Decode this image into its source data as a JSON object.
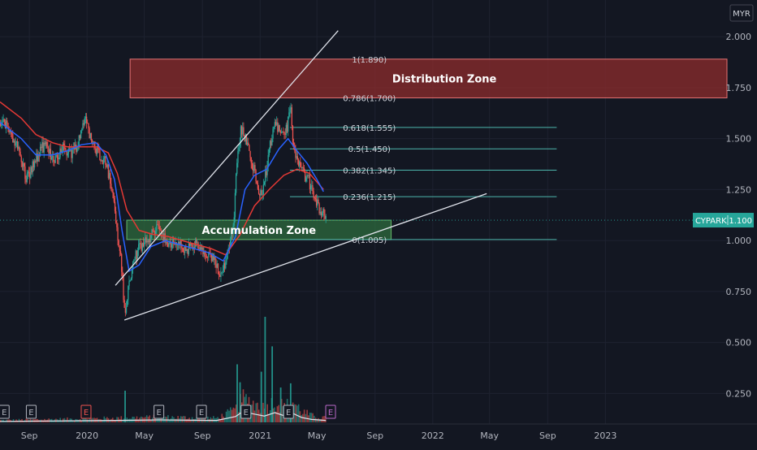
{
  "chart_data": {
    "type": "candlestick",
    "symbol": "CYPARK",
    "currency": "MYR",
    "last_price": "1.100",
    "colors": {
      "background": "#131722",
      "grid": "#1e2230",
      "axis_text": "#b2b5be",
      "up": "#26a69a",
      "down": "#ef5350",
      "ma_fast": "#2962ff",
      "ma_slow": "#e53935",
      "trendline": "#e0e3eb",
      "fib_line": "#4db6ac",
      "distribution_fill": "#8e2c2c",
      "distribution_border": "#e57373",
      "accumulation_fill": "#2e6b3e",
      "accumulation_border": "#66bb6a",
      "price_badge": "#26a69a",
      "earnings_default": "#b2b5be",
      "earnings_miss": "#ef5350",
      "earnings_upcoming": "#ba68c8",
      "volume_ma": "#e0e3eb"
    },
    "y_axis": {
      "min": 0.1,
      "max": 2.18,
      "ticks": [
        {
          "value": 0.25,
          "label": "0.250"
        },
        {
          "value": 0.5,
          "label": "0.500"
        },
        {
          "value": 0.75,
          "label": "0.750"
        },
        {
          "value": 1.0,
          "label": "1.000"
        },
        {
          "value": 1.25,
          "label": "1.250"
        },
        {
          "value": 1.5,
          "label": "1.500"
        },
        {
          "value": 1.75,
          "label": "1.750"
        },
        {
          "value": 2.0,
          "label": "2.000"
        }
      ]
    },
    "x_axis": {
      "start": "2019-07-01",
      "end": "2023-09-15",
      "ticks": [
        {
          "date": "2019-09-01",
          "label": "Sep"
        },
        {
          "date": "2020-01-01",
          "label": "2020"
        },
        {
          "date": "2020-05-01",
          "label": "May"
        },
        {
          "date": "2020-09-01",
          "label": "Sep"
        },
        {
          "date": "2021-01-01",
          "label": "2021"
        },
        {
          "date": "2021-05-01",
          "label": "May"
        },
        {
          "date": "2021-09-01",
          "label": "Sep"
        },
        {
          "date": "2022-01-01",
          "label": "2022"
        },
        {
          "date": "2022-05-01",
          "label": "May"
        },
        {
          "date": "2022-09-01",
          "label": "Sep"
        },
        {
          "date": "2023-01-01",
          "label": "2023"
        }
      ]
    },
    "price_path": [
      [
        "2019-07-01",
        1.58
      ],
      [
        "2019-07-20",
        1.55
      ],
      [
        "2019-08-10",
        1.43
      ],
      [
        "2019-08-25",
        1.3
      ],
      [
        "2019-09-10",
        1.38
      ],
      [
        "2019-10-01",
        1.47
      ],
      [
        "2019-10-20",
        1.4
      ],
      [
        "2019-11-10",
        1.45
      ],
      [
        "2019-12-01",
        1.43
      ],
      [
        "2019-12-15",
        1.5
      ],
      [
        "2019-12-28",
        1.62
      ],
      [
        "2020-01-10",
        1.47
      ],
      [
        "2020-01-25",
        1.43
      ],
      [
        "2020-02-10",
        1.38
      ],
      [
        "2020-02-25",
        1.2
      ],
      [
        "2020-03-05",
        1.02
      ],
      [
        "2020-03-12",
        0.9
      ],
      [
        "2020-03-20",
        0.62
      ],
      [
        "2020-03-28",
        0.78
      ],
      [
        "2020-04-10",
        0.92
      ],
      [
        "2020-04-25",
        0.98
      ],
      [
        "2020-05-10",
        1.0
      ],
      [
        "2020-05-25",
        1.07
      ],
      [
        "2020-06-05",
        1.05
      ],
      [
        "2020-06-20",
        0.96
      ],
      [
        "2020-07-05",
        1.0
      ],
      [
        "2020-07-25",
        0.95
      ],
      [
        "2020-08-15",
        0.98
      ],
      [
        "2020-09-05",
        0.93
      ],
      [
        "2020-09-25",
        0.9
      ],
      [
        "2020-10-10",
        0.83
      ],
      [
        "2020-10-25",
        0.96
      ],
      [
        "2020-11-05",
        1.1
      ],
      [
        "2020-11-12",
        1.38
      ],
      [
        "2020-11-20",
        1.55
      ],
      [
        "2020-12-01",
        1.5
      ],
      [
        "2020-12-10",
        1.4
      ],
      [
        "2020-12-20",
        1.35
      ],
      [
        "2020-12-30",
        1.2
      ],
      [
        "2021-01-10",
        1.3
      ],
      [
        "2021-01-20",
        1.45
      ],
      [
        "2021-02-01",
        1.6
      ],
      [
        "2021-02-12",
        1.5
      ],
      [
        "2021-02-25",
        1.55
      ],
      [
        "2021-03-05",
        1.66
      ],
      [
        "2021-03-12",
        1.45
      ],
      [
        "2021-03-20",
        1.38
      ],
      [
        "2021-04-01",
        1.33
      ],
      [
        "2021-04-12",
        1.3
      ],
      [
        "2021-04-25",
        1.2
      ],
      [
        "2021-05-08",
        1.15
      ],
      [
        "2021-05-20",
        1.1
      ]
    ],
    "ma_fast": [
      [
        "2019-07-01",
        1.58
      ],
      [
        "2019-08-15",
        1.5
      ],
      [
        "2019-09-15",
        1.42
      ],
      [
        "2019-10-20",
        1.42
      ],
      [
        "2019-11-20",
        1.44
      ],
      [
        "2019-12-20",
        1.47
      ],
      [
        "2020-01-20",
        1.48
      ],
      [
        "2020-02-10",
        1.42
      ],
      [
        "2020-02-28",
        1.3
      ],
      [
        "2020-03-15",
        1.05
      ],
      [
        "2020-03-30",
        0.85
      ],
      [
        "2020-04-20",
        0.88
      ],
      [
        "2020-05-15",
        0.97
      ],
      [
        "2020-06-15",
        1.0
      ],
      [
        "2020-07-15",
        0.98
      ],
      [
        "2020-08-15",
        0.96
      ],
      [
        "2020-09-15",
        0.94
      ],
      [
        "2020-10-15",
        0.9
      ],
      [
        "2020-11-10",
        1.02
      ],
      [
        "2020-11-30",
        1.25
      ],
      [
        "2020-12-20",
        1.32
      ],
      [
        "2021-01-15",
        1.35
      ],
      [
        "2021-02-10",
        1.45
      ],
      [
        "2021-03-01",
        1.5
      ],
      [
        "2021-03-20",
        1.44
      ],
      [
        "2021-04-10",
        1.38
      ],
      [
        "2021-05-01",
        1.3
      ],
      [
        "2021-05-15",
        1.24
      ]
    ],
    "ma_slow": [
      [
        "2019-07-01",
        1.68
      ],
      [
        "2019-08-15",
        1.6
      ],
      [
        "2019-09-15",
        1.52
      ],
      [
        "2019-10-20",
        1.48
      ],
      [
        "2019-11-20",
        1.46
      ],
      [
        "2019-12-20",
        1.46
      ],
      [
        "2020-01-20",
        1.46
      ],
      [
        "2020-02-15",
        1.43
      ],
      [
        "2020-03-05",
        1.33
      ],
      [
        "2020-03-25",
        1.15
      ],
      [
        "2020-04-20",
        1.05
      ],
      [
        "2020-05-20",
        1.03
      ],
      [
        "2020-06-20",
        1.02
      ],
      [
        "2020-07-20",
        1.0
      ],
      [
        "2020-08-20",
        0.98
      ],
      [
        "2020-09-20",
        0.96
      ],
      [
        "2020-10-20",
        0.93
      ],
      [
        "2020-11-20",
        1.03
      ],
      [
        "2020-12-20",
        1.17
      ],
      [
        "2021-01-20",
        1.25
      ],
      [
        "2021-02-20",
        1.32
      ],
      [
        "2021-03-20",
        1.35
      ],
      [
        "2021-04-15",
        1.33
      ],
      [
        "2021-05-15",
        1.25
      ]
    ],
    "volume_ma": [
      [
        "2019-07-01",
        0.02
      ],
      [
        "2020-03-01",
        0.04
      ],
      [
        "2020-06-01",
        0.05
      ],
      [
        "2020-10-01",
        0.04
      ],
      [
        "2020-11-10",
        0.12
      ],
      [
        "2020-11-25",
        0.22
      ],
      [
        "2020-12-20",
        0.17
      ],
      [
        "2021-01-10",
        0.13
      ],
      [
        "2021-02-01",
        0.2
      ],
      [
        "2021-02-20",
        0.14
      ],
      [
        "2021-03-10",
        0.19
      ],
      [
        "2021-03-30",
        0.1
      ],
      [
        "2021-04-20",
        0.06
      ],
      [
        "2021-05-20",
        0.04
      ]
    ],
    "volume_spikes": [
      [
        "2020-11-12",
        0.55
      ],
      [
        "2020-11-18",
        0.38
      ],
      [
        "2021-01-02",
        0.48
      ],
      [
        "2021-01-10",
        1.0
      ],
      [
        "2021-01-25",
        0.72
      ],
      [
        "2021-02-12",
        0.33
      ],
      [
        "2021-03-05",
        0.37
      ],
      [
        "2020-03-20",
        0.3
      ]
    ],
    "trendlines": [
      {
        "name": "upper-channel",
        "from": [
          "2020-03-01",
          0.78
        ],
        "to": [
          "2021-06-15",
          2.03
        ]
      },
      {
        "name": "lower-support",
        "from": [
          "2020-03-20",
          0.61
        ],
        "to": [
          "2022-04-25",
          1.23
        ]
      }
    ],
    "zones": [
      {
        "name": "distribution",
        "label": "Distribution Zone",
        "from": "2020-04-01",
        "to": "2023-09-15",
        "top": 1.89,
        "bottom": 1.7
      },
      {
        "name": "accumulation",
        "label": "Accumulation Zone",
        "from": "2020-03-25",
        "to": "2021-10-05",
        "top": 1.1,
        "bottom": 1.005
      }
    ],
    "fib_levels": [
      {
        "value": 1.89,
        "label": "1(1.890)",
        "start": "2021-03-05"
      },
      {
        "value": 1.7,
        "label": "0.786(1.700)",
        "start": "2021-03-05"
      },
      {
        "value": 1.555,
        "label": "0.618(1.555)",
        "start": "2021-03-05"
      },
      {
        "value": 1.45,
        "label": "0.5(1.450)",
        "start": "2021-03-05"
      },
      {
        "value": 1.345,
        "label": "0.382(1.345)",
        "start": "2021-03-05"
      },
      {
        "value": 1.215,
        "label": "0.236(1.215)",
        "start": "2021-03-05"
      },
      {
        "value": 1.005,
        "label": "0(1.005)",
        "start": "2021-03-05"
      }
    ],
    "fib_label_date": "2021-08-20",
    "fib_end_date": "2022-09-20",
    "earnings_markers": [
      {
        "date": "2019-07-10",
        "label": "E",
        "kind": "default"
      },
      {
        "date": "2019-09-05",
        "label": "E",
        "kind": "default"
      },
      {
        "date": "2019-12-30",
        "label": "E",
        "kind": "miss"
      },
      {
        "date": "2020-06-01",
        "label": "E",
        "kind": "default"
      },
      {
        "date": "2020-08-30",
        "label": "E",
        "kind": "default"
      },
      {
        "date": "2020-12-02",
        "label": "E",
        "kind": "default"
      },
      {
        "date": "2021-03-02",
        "label": "E",
        "kind": "default"
      },
      {
        "date": "2021-05-30",
        "label": "E",
        "kind": "upcoming"
      }
    ]
  }
}
